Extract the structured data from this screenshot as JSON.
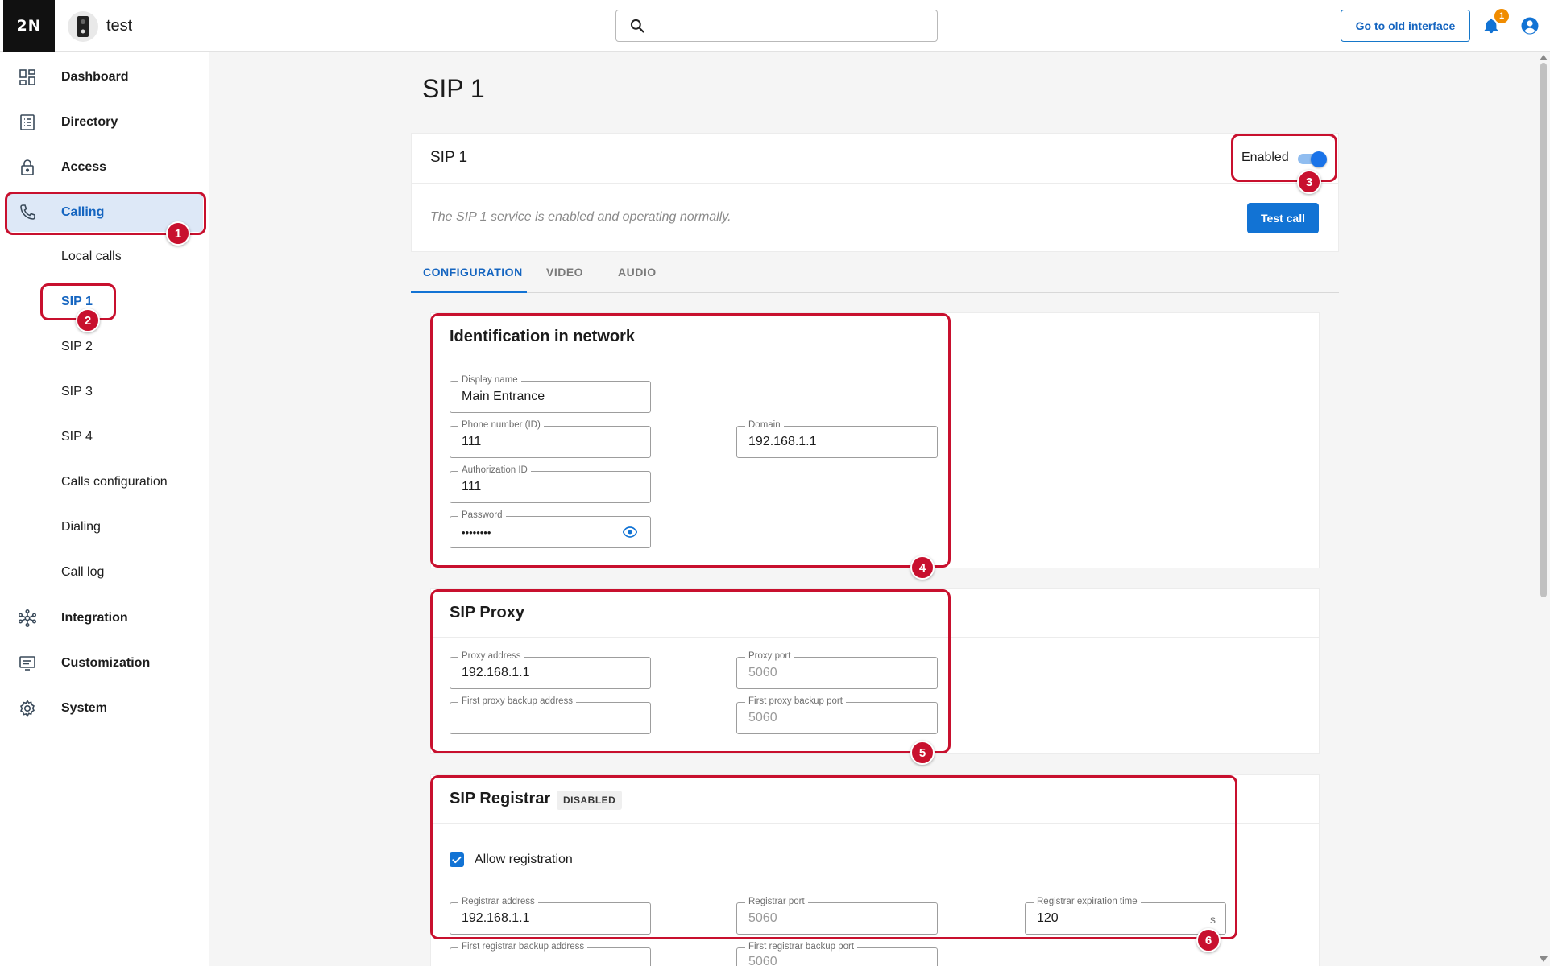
{
  "header": {
    "logo": "2N",
    "device_name": "test",
    "search_placeholder": "",
    "old_interface_label": "Go to old interface",
    "notification_count": "1"
  },
  "sidebar": {
    "items": [
      {
        "label": "Dashboard",
        "icon": "dashboard-icon"
      },
      {
        "label": "Directory",
        "icon": "directory-icon"
      },
      {
        "label": "Access",
        "icon": "lock-icon"
      },
      {
        "label": "Calling",
        "icon": "phone-icon",
        "active": true
      },
      {
        "label": "Integration",
        "icon": "integration-icon"
      },
      {
        "label": "Customization",
        "icon": "customization-icon"
      },
      {
        "label": "System",
        "icon": "gear-icon"
      }
    ],
    "calling_subitems": [
      {
        "label": "Local calls"
      },
      {
        "label": "SIP 1",
        "active": true
      },
      {
        "label": "SIP 2"
      },
      {
        "label": "SIP 3"
      },
      {
        "label": "SIP 4"
      },
      {
        "label": "Calls configuration"
      },
      {
        "label": "Dialing"
      },
      {
        "label": "Call log"
      }
    ]
  },
  "page": {
    "title": "SIP 1",
    "service": {
      "title": "SIP 1",
      "enabled_label": "Enabled",
      "enabled": true,
      "status_text": "The SIP 1 service is enabled and operating normally.",
      "test_call_label": "Test call"
    },
    "tabs": [
      {
        "label": "CONFIGURATION",
        "active": true
      },
      {
        "label": "VIDEO"
      },
      {
        "label": "AUDIO"
      }
    ]
  },
  "identification": {
    "title": "Identification in network",
    "display_name": {
      "label": "Display name",
      "value": "Main Entrance"
    },
    "phone_number": {
      "label": "Phone number (ID)",
      "value": "111"
    },
    "domain": {
      "label": "Domain",
      "value": "192.168.1.1"
    },
    "authorization_id": {
      "label": "Authorization ID",
      "value": "111"
    },
    "password": {
      "label": "Password",
      "value": "••••••••"
    }
  },
  "proxy": {
    "title": "SIP Proxy",
    "proxy_address": {
      "label": "Proxy address",
      "value": "192.168.1.1"
    },
    "proxy_port": {
      "label": "Proxy port",
      "value": "5060"
    },
    "backup_address": {
      "label": "First proxy backup address",
      "value": ""
    },
    "backup_port": {
      "label": "First proxy backup port",
      "value": "5060"
    }
  },
  "registrar": {
    "title": "SIP Registrar",
    "badge": "DISABLED",
    "allow_registration_label": "Allow registration",
    "allow_registration": true,
    "registrar_address": {
      "label": "Registrar address",
      "value": "192.168.1.1"
    },
    "registrar_port": {
      "label": "Registrar port",
      "value": "5060"
    },
    "expiration": {
      "label": "Registrar expiration time",
      "value": "120",
      "unit": "s"
    },
    "backup_address": {
      "label": "First registrar backup address",
      "value": ""
    },
    "backup_port": {
      "label": "First registrar backup port",
      "value": "5060"
    }
  },
  "annotations": [
    "1",
    "2",
    "3",
    "4",
    "5",
    "6"
  ],
  "colors": {
    "accent": "#1273d4",
    "annotation": "#c8102e",
    "notification": "#f08c00",
    "sidebar_active": "#dde8f7"
  }
}
